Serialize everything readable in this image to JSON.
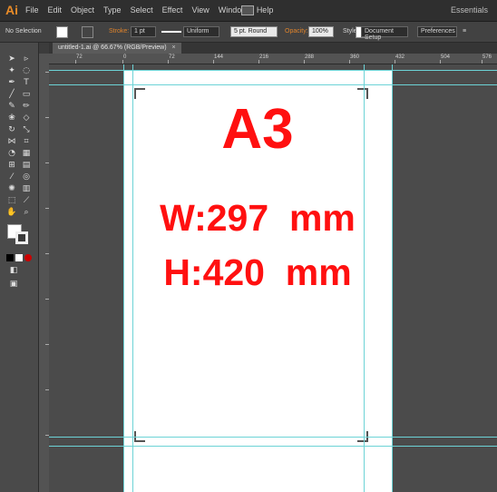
{
  "app": {
    "logo": "Ai",
    "workspace": "Essentials"
  },
  "menu": [
    "File",
    "Edit",
    "Object",
    "Type",
    "Select",
    "Effect",
    "View",
    "Window",
    "Help"
  ],
  "control_bar": {
    "selection": "No Selection",
    "stroke_label": "Stroke:",
    "stroke_weight": "1 pt",
    "profile": "Uniform",
    "brush": "5 pt. Round",
    "opacity_label": "Opacity:",
    "opacity_value": "100%",
    "style_label": "Style:",
    "document_setup": "Document Setup",
    "preferences": "Preferences"
  },
  "document_tab": {
    "label": "untitled-1.ai @ 66.67% (RGB/Preview)",
    "close": "×"
  },
  "ruler": {
    "labels": [
      "72",
      "0",
      "72",
      "144",
      "216",
      "288",
      "360",
      "432",
      "504",
      "576"
    ]
  },
  "artboard": {
    "title": "A3",
    "width_text": "W:297  mm",
    "height_text": "H:420  mm"
  },
  "colors": {
    "accent_red": "#ff1010",
    "guide": "#6cd3d6",
    "logo": "#e88b28"
  },
  "tools": [
    "selection-icon",
    "direct-selection-icon",
    "magic-wand-icon",
    "lasso-icon",
    "pen-icon",
    "type-icon",
    "line-icon",
    "rectangle-icon",
    "paintbrush-icon",
    "pencil-icon",
    "blob-brush-icon",
    "eraser-icon",
    "rotate-icon",
    "scale-icon",
    "width-icon",
    "free-transform-icon",
    "shape-builder-icon",
    "perspective-icon",
    "mesh-icon",
    "gradient-icon",
    "eyedropper-icon",
    "blend-icon",
    "symbol-sprayer-icon",
    "column-graph-icon",
    "artboard-icon",
    "slice-icon",
    "hand-icon",
    "zoom-icon"
  ]
}
